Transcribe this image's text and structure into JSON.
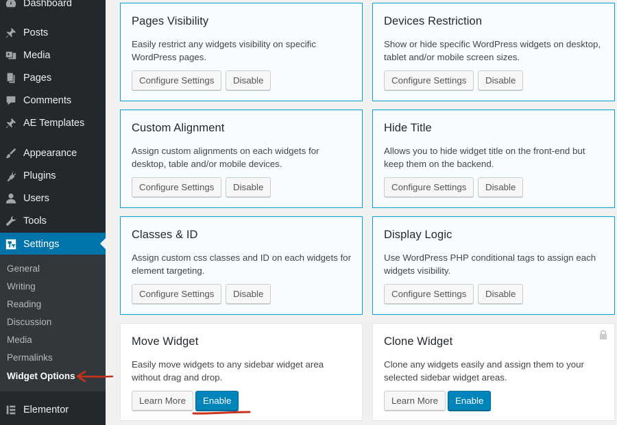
{
  "sidebar": {
    "items": [
      {
        "label": "Dashboard",
        "icon": "dashboard-icon"
      },
      {
        "label": "Posts",
        "icon": "pin-icon"
      },
      {
        "label": "Media",
        "icon": "media-icon"
      },
      {
        "label": "Pages",
        "icon": "pages-icon"
      },
      {
        "label": "Comments",
        "icon": "comment-icon"
      },
      {
        "label": "AE Templates",
        "icon": "pin-icon"
      },
      {
        "label": "Appearance",
        "icon": "brush-icon"
      },
      {
        "label": "Plugins",
        "icon": "plug-icon"
      },
      {
        "label": "Users",
        "icon": "user-icon"
      },
      {
        "label": "Tools",
        "icon": "wrench-icon"
      },
      {
        "label": "Settings",
        "icon": "settings-icon"
      },
      {
        "label": "Elementor",
        "icon": "elementor-icon"
      }
    ],
    "submenu": [
      "General",
      "Writing",
      "Reading",
      "Discussion",
      "Media",
      "Permalinks",
      "Widget Options"
    ]
  },
  "cards": [
    {
      "title": "Pages Visibility",
      "desc": "Easily restrict any widgets visibility on specific WordPress pages.",
      "btn1": "Configure Settings",
      "btn2": "Disable"
    },
    {
      "title": "Devices Restriction",
      "desc": "Show or hide specific WordPress widgets on desktop, tablet and/or mobile screen sizes.",
      "btn1": "Configure Settings",
      "btn2": "Disable"
    },
    {
      "title": "Custom Alignment",
      "desc": "Assign custom alignments on each widgets for desktop, table and/or mobile devices.",
      "btn1": "Configure Settings",
      "btn2": "Disable"
    },
    {
      "title": "Hide Title",
      "desc": "Allows you to hide widget title on the front-end but keep them on the backend.",
      "btn1": "Configure Settings",
      "btn2": "Disable"
    },
    {
      "title": "Classes & ID",
      "desc": "Assign custom css classes and ID on each widgets for element targeting.",
      "btn1": "Configure Settings",
      "btn2": "Disable"
    },
    {
      "title": "Display Logic",
      "desc": "Use WordPress PHP conditional tags to assign each widgets visibility.",
      "btn1": "Configure Settings",
      "btn2": "Disable"
    },
    {
      "title": "Move Widget",
      "desc": "Easily move widgets to any sidebar widget area without drag and drop.",
      "btn1": "Learn More",
      "btn2": "Enable"
    },
    {
      "title": "Clone Widget",
      "desc": "Clone any widgets easily and assign them to your selected sidebar widget areas.",
      "btn1": "Learn More",
      "btn2": "Enable"
    }
  ],
  "colors": {
    "sidebar_bg": "#23282d",
    "submenu_bg": "#32373c",
    "accent": "#0073aa",
    "active_card_border": "#00a0d2",
    "annotation_red": "#c9321d"
  }
}
